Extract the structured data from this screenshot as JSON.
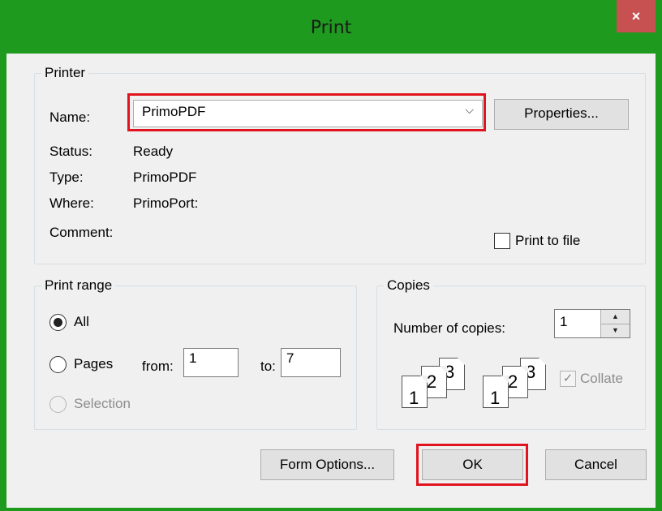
{
  "window": {
    "title": "Print",
    "close_glyph": "×"
  },
  "printer": {
    "group_label": "Printer",
    "name_label": "Name:",
    "name_value": "PrimoPDF",
    "properties_button": "Properties...",
    "status_label": "Status:",
    "status_value": "Ready",
    "type_label": "Type:",
    "type_value": "PrimoPDF",
    "where_label": "Where:",
    "where_value": "PrimoPort:",
    "comment_label": "Comment:",
    "print_to_file_label": "Print to file",
    "print_to_file_checked": false
  },
  "print_range": {
    "group_label": "Print range",
    "all_label": "All",
    "pages_label": "Pages",
    "from_label": "from:",
    "from_value": "1",
    "to_label": "to:",
    "to_value": "7",
    "selection_label": "Selection",
    "selected": "all"
  },
  "copies": {
    "group_label": "Copies",
    "number_label": "Number of copies:",
    "number_value": "1",
    "collate_label": "Collate",
    "collate_checked": true,
    "pages_stack": [
      "1",
      "2",
      "3"
    ]
  },
  "buttons": {
    "form_options": "Form Options...",
    "ok": "OK",
    "cancel": "Cancel"
  },
  "colors": {
    "frame": "#1e9a1e",
    "highlight": "#e0141e",
    "close": "#c75050"
  }
}
